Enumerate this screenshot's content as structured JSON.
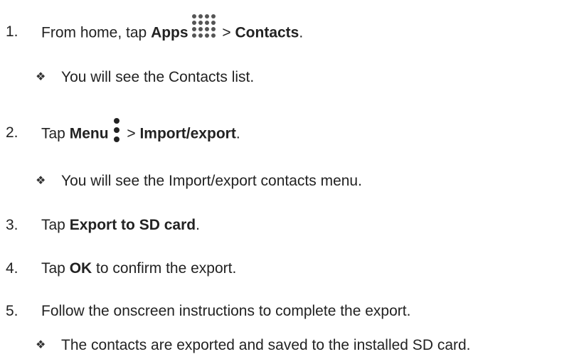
{
  "steps": [
    {
      "num": "1.",
      "pre": "From home, tap ",
      "b1": "Apps",
      "mid": " > ",
      "b2": "Contacts",
      "post": ".",
      "icon": "apps-grid-icon"
    },
    {
      "bullet": "You will see the Contacts list."
    },
    {
      "num": "2.",
      "pre": "Tap ",
      "b1": "Menu",
      "mid": " > ",
      "b2": "Import/export",
      "post": ".",
      "icon": "menu-dots-icon"
    },
    {
      "bullet": "You will see the Import/export contacts menu."
    },
    {
      "num": "3.",
      "pre": "Tap ",
      "b1": "Export to SD card",
      "post": "."
    },
    {
      "num": "4.",
      "pre": "Tap ",
      "b1": "OK",
      "post": " to confirm the export."
    },
    {
      "num": "5.",
      "pre": "Follow the onscreen instructions to complete the export."
    },
    {
      "bullet": "The contacts are exported and saved to the installed SD card."
    }
  ],
  "bullet_glyph": "❖"
}
